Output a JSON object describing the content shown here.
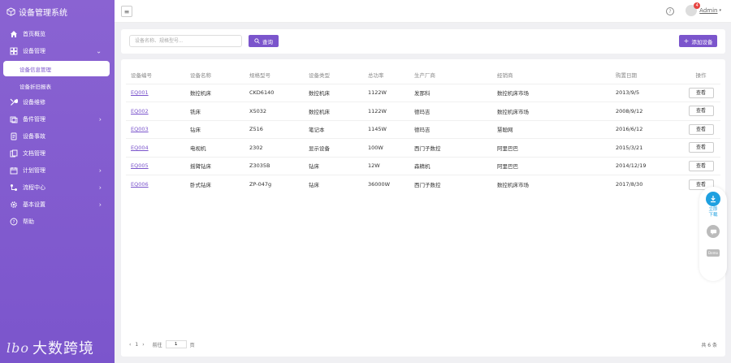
{
  "app": {
    "title": "设备管理系统"
  },
  "sidebar": {
    "items": [
      {
        "label": "首页概览",
        "icon": "home-icon",
        "has_arrow": false
      },
      {
        "label": "设备管理",
        "icon": "grid-icon",
        "has_arrow": true,
        "expanded": true
      },
      {
        "label": "设备维修",
        "icon": "wrench-icon",
        "has_arrow": false
      },
      {
        "label": "备件管理",
        "icon": "box-icon",
        "has_arrow": true
      },
      {
        "label": "设备事故",
        "icon": "document-icon",
        "has_arrow": false
      },
      {
        "label": "文档管理",
        "icon": "files-icon",
        "has_arrow": false
      },
      {
        "label": "计划管理",
        "icon": "calendar-icon",
        "has_arrow": true
      },
      {
        "label": "流程中心",
        "icon": "flow-icon",
        "has_arrow": true
      },
      {
        "label": "基本设置",
        "icon": "gear-icon",
        "has_arrow": true
      },
      {
        "label": "帮助",
        "icon": "help-icon",
        "has_arrow": false
      }
    ],
    "sub_items": [
      {
        "label": "设备信息管理",
        "active": true
      },
      {
        "label": "设备折旧报表",
        "active": false
      }
    ],
    "brand_text": "大数跨境"
  },
  "topbar": {
    "notification_count": "4",
    "user_name": "Admin"
  },
  "search": {
    "placeholder": "设备名称、规格型号...",
    "button_label": "查询",
    "add_label": "添加设备"
  },
  "table": {
    "columns": [
      "设备编号",
      "设备名称",
      "规格型号",
      "设备类型",
      "总功率",
      "生产厂商",
      "经销商",
      "购置日期",
      "操作"
    ],
    "rows": [
      {
        "code": "EQ001",
        "name": "数控机床",
        "model": "CKD6140",
        "type": "数控机床",
        "power": "1122W",
        "maker": "发那科",
        "dealer": "数控机床市场",
        "date": "2013/9/5",
        "action": "查看"
      },
      {
        "code": "EQ002",
        "name": "铣床",
        "model": "X5032",
        "type": "数控机床",
        "power": "1122W",
        "maker": "德玛吉",
        "dealer": "数控机床市场",
        "date": "2008/9/12",
        "action": "查看"
      },
      {
        "code": "EQ003",
        "name": "钻床",
        "model": "Z516",
        "type": "笔记本",
        "power": "1145W",
        "maker": "德玛吉",
        "dealer": "慧聪网",
        "date": "2016/6/12",
        "action": "查看"
      },
      {
        "code": "EQ004",
        "name": "电视机",
        "model": "2302",
        "type": "显示设备",
        "power": "100W",
        "maker": "西门子数控",
        "dealer": "阿里巴巴",
        "date": "2015/3/21",
        "action": "查看"
      },
      {
        "code": "EQ005",
        "name": "摇臂钻床",
        "model": "Z3035B",
        "type": "钻床",
        "power": "12W",
        "maker": "森精机",
        "dealer": "阿里巴巴",
        "date": "2014/12/19",
        "action": "查看"
      },
      {
        "code": "EQ006",
        "name": "卧式钻床",
        "model": "ZP-047g",
        "type": "钻床",
        "power": "36000W",
        "maker": "西门子数控",
        "dealer": "数控机床市场",
        "date": "2017/8/30",
        "action": "查看"
      }
    ]
  },
  "pager": {
    "prev": "‹",
    "page": "1",
    "next": "›",
    "goto_label": "前往",
    "goto_value": "1",
    "page_suffix": "页",
    "total_text": "共 6 条"
  },
  "float_tools": {
    "download_label": "立即下载",
    "demo_label": "Demo"
  },
  "colors": {
    "accent": "#7b55cc",
    "sidebar": "#8a63d2",
    "download": "#1ea0e0"
  }
}
